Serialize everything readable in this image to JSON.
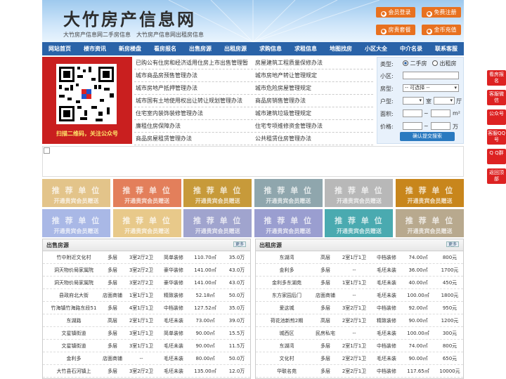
{
  "header": {
    "logo": "大竹房产信息网",
    "sub": "大竹房产信息网二手房信息　大竹房产信息网出租房信息",
    "buttons": [
      "会员登录",
      "免费注册",
      "房贵套餐",
      "金币充值"
    ]
  },
  "nav": [
    "网站首页",
    "楼市资讯",
    "新房楼盘",
    "看房报名",
    "出售房源",
    "出租房源",
    "求购信息",
    "求租信息",
    "地图找房",
    "小区大全",
    "中介名录",
    "联系客服"
  ],
  "qr_caption": "扫描二维码，关注公众号",
  "links": [
    [
      "已购公有住房和经济适用住房上市出售管理暂",
      "房屋建筑工程质量保修办法"
    ],
    [
      "城市商品房预售管理办法",
      "城市房地产转让管理规定"
    ],
    [
      "城市房地产抵押管理办法",
      "城市危险房屋管理规定"
    ],
    [
      "城市国有土地使用权出让转让规划管理办法",
      "商品房销售管理办法"
    ],
    [
      "住宅室内装饰装修管理办法",
      "城市建筑垃圾管理规定"
    ],
    [
      "廉租住房保障办法",
      "住宅专项维修资金管理办法"
    ],
    [
      "商品房屋租赁管理办法",
      "公共租赁住房管理办法"
    ]
  ],
  "search": {
    "type_label": "类型:",
    "opt1": "二手房",
    "opt2": "出租房",
    "xq": "小区:",
    "fx": "房型:",
    "select": "-- 可选择 --",
    "hx": "户型:",
    "shi": "室",
    "ting": "厅",
    "mj": "面积:",
    "jg": "价格:",
    "tilde": "~",
    "m2": "m²",
    "wan": "万",
    "btn": "确认提交搜索"
  },
  "promo": {
    "t1": "推 荐 单 位",
    "t2": "开通贵宾会员赠送",
    "colors": [
      "#e3c48a",
      "#e37f5b",
      "#c79a3a",
      "#8fa6ad",
      "#b8b8b8",
      "#c8861c",
      "#a9b8e6",
      "#e8c98a",
      "#a0a4ce",
      "#9a9ed0",
      "#4aaab0",
      "#b8a98e"
    ]
  },
  "sale": {
    "title": "出售房源",
    "more": "更多",
    "rows": [
      [
        "竹中附近文化村",
        "多层",
        "3室2厅2卫",
        "简单装修",
        "110.70㎡",
        "35.0万"
      ],
      [
        "洞天物价局家属院",
        "多层",
        "3室2厅2卫",
        "豪华装修",
        "141.00㎡",
        "43.0万"
      ],
      [
        "洞天物价局家属院",
        "多层",
        "3室2厅2卫",
        "豪华装修",
        "141.00㎡",
        "43.0万"
      ],
      [
        "县政府北大街",
        "店面商铺",
        "1室1厅1卫",
        "精致装修",
        "52.18㎡",
        "50.0万"
      ],
      [
        "竹海镇竹海路东段51",
        "多层",
        "4室1厅1卫",
        "中档装修",
        "127.52㎡",
        "35.0万"
      ],
      [
        "东湖路",
        "高层",
        "2室1厅1卫",
        "毛坯未装",
        "73.00㎡",
        "39.0万"
      ],
      [
        "文星镇街道",
        "多层",
        "3室1厅1卫",
        "简单装修",
        "90.00㎡",
        "15.5万"
      ],
      [
        "文星镇街道",
        "多层",
        "3室1厅1卫",
        "毛坯未装",
        "90.00㎡",
        "11.5万"
      ],
      [
        "金利多",
        "店面商铺",
        "--",
        "毛坯未装",
        "80.00㎡",
        "50.0万"
      ],
      [
        "大竹县石河镇上",
        "多层",
        "3室2厅2卫",
        "毛坯未装",
        "135.00㎡",
        "12.0万"
      ]
    ]
  },
  "rent": {
    "title": "出租房源",
    "more": "更多",
    "rows": [
      [
        "东湖湾",
        "高层",
        "2室1厅1卫",
        "中档装修",
        "74.00㎡",
        "800元"
      ],
      [
        "金利多",
        "多层",
        "--",
        "毛坯未装",
        "36.00㎡",
        "1700元"
      ],
      [
        "金利多东湖苑",
        "多层",
        "1室1厅1卫",
        "毛坯未装",
        "40.00㎡",
        "450元"
      ],
      [
        "东方家园后门",
        "店面商铺",
        "--",
        "毛坯未装",
        "100.00㎡",
        "1800元"
      ],
      [
        "爱这城",
        "多层",
        "3室2厅1卫",
        "中档装修",
        "92.00㎡",
        "950元"
      ],
      [
        "荷花池新煎2期",
        "高层",
        "2室2厅1卫",
        "精致装修",
        "90.00㎡",
        "1200元"
      ],
      [
        "城西区",
        "民房私宅",
        "--",
        "毛坯未装",
        "100.00㎡",
        "300元"
      ],
      [
        "东湖湾",
        "多层",
        "2室1厅1卫",
        "中档装修",
        "74.00㎡",
        "800元"
      ],
      [
        "文化村",
        "多层",
        "2室2厅1卫",
        "毛坯未装",
        "90.00㎡",
        "650元"
      ],
      [
        "华联名苑",
        "多层",
        "2室2厅1卫",
        "中档装修",
        "117.65㎡",
        "10000元"
      ]
    ]
  },
  "side": [
    "看房报名",
    "客服微信",
    "公众号",
    "客服QQ号",
    "Q Q群",
    "返回顶部"
  ]
}
